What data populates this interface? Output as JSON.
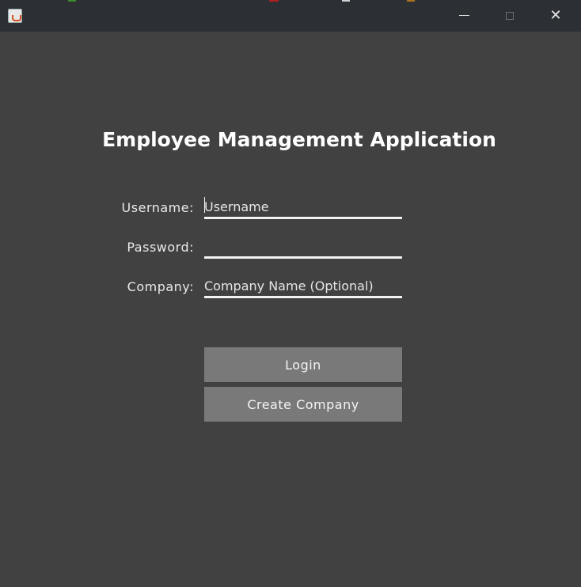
{
  "window": {
    "minimize_icon": "minimize-icon",
    "maximize_icon": "maximize-icon",
    "close_icon": "close-icon",
    "close_glyph": "✕"
  },
  "app_title": "Employee Management Application",
  "form": {
    "username_label": "Username:",
    "username_placeholder": "Username",
    "password_label": "Password:",
    "password_value": "",
    "company_label": "Company:",
    "company_placeholder": "Company Name (Optional)"
  },
  "buttons": {
    "login": "Login",
    "create_company": "Create Company"
  },
  "colors": {
    "background": "#414141",
    "titlebar": "#2c3035",
    "button": "#797979",
    "text": "#ffffff"
  }
}
